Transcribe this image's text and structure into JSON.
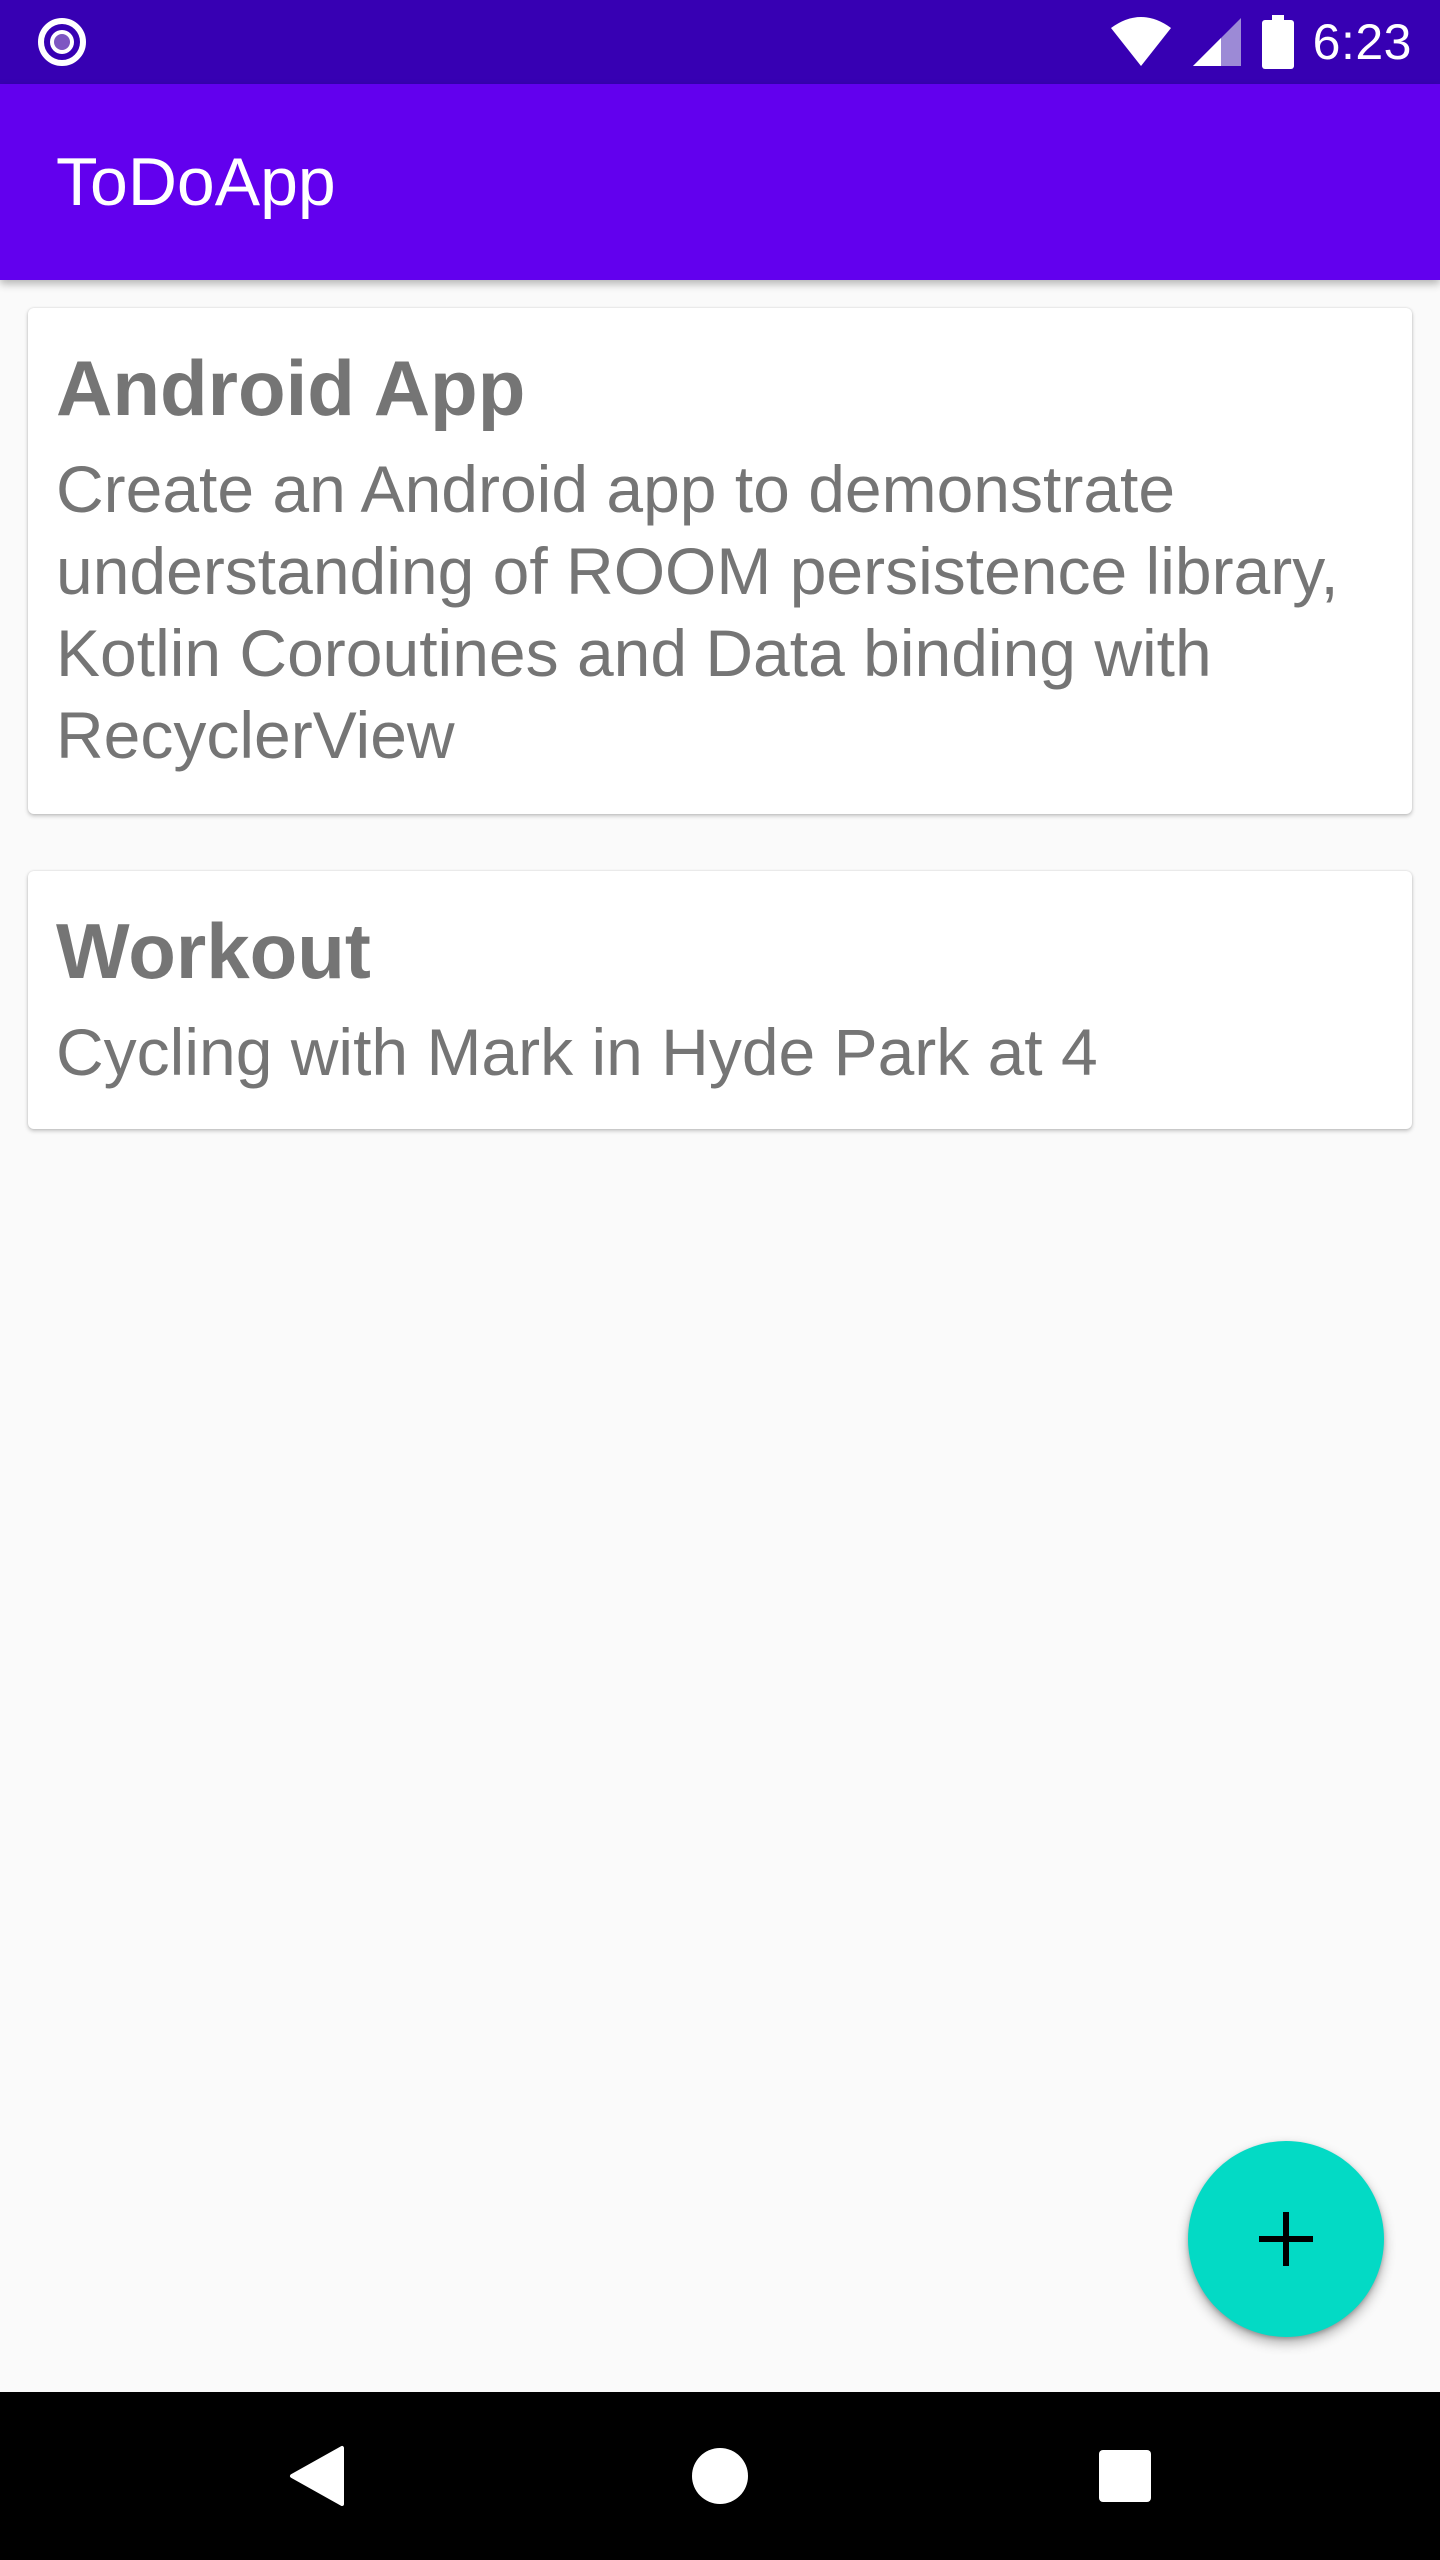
{
  "status_bar": {
    "time": "6:23",
    "left_icon": "notification-dot-icon",
    "icons": [
      "wifi-icon",
      "signal-icon",
      "battery-icon"
    ]
  },
  "app_bar": {
    "title": "ToDoApp"
  },
  "todos": [
    {
      "title": "Android App",
      "description": "Create an Android app to demonstrate understanding of ROOM persistence library, Kotlin Coroutines and Data binding with RecyclerView"
    },
    {
      "title": "Workout",
      "description": "Cycling with Mark in Hyde Park at 4"
    }
  ],
  "fab": {
    "icon": "add-icon"
  },
  "nav_bar": {
    "icons": [
      "back-icon",
      "home-icon",
      "recents-icon"
    ]
  },
  "colors": {
    "status_bar": "#3700b3",
    "primary": "#6200ee",
    "accent": "#03dac5",
    "text_secondary": "#757575",
    "background": "#fafafa"
  }
}
